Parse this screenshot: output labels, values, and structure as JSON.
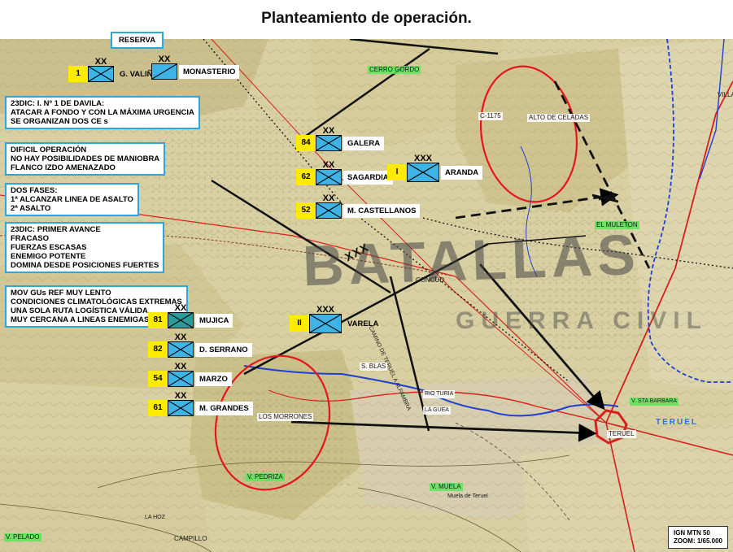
{
  "title": "Planteamiento de operación.",
  "reserva_label": "RESERVA",
  "notes": [
    {
      "id": "davila",
      "lines": [
        "23DIC: I. Nº 1 DE DAVILA:",
        "ATACAR A FONDO Y CON LA MÁXIMA URGENCIA",
        "SE ORGANIZAN DOS CE s"
      ]
    },
    {
      "id": "dificil",
      "lines": [
        "DIFICIL OPERACIÓN",
        "NO HAY POSIBILIDADES DE MANIOBRA",
        "FLANCO IZDO AMENAZADO"
      ]
    },
    {
      "id": "fases",
      "lines": [
        "DOS FASES:",
        "1ª ALCANZAR LINEA DE ASALTO",
        "2ª ASALTO"
      ]
    },
    {
      "id": "avance",
      "lines": [
        "23DIC: PRIMER AVANCE",
        "FRACASO",
        "FUERZAS ESCASAS",
        "ENEMIGO POTENTE",
        "DOMINA DESDE POSICIONES FUERTES"
      ]
    },
    {
      "id": "mov",
      "lines": [
        "MOV GUs REF MUY LENTO",
        "CONDICIONES CLIMATOLÓGICAS EXTREMAS",
        "UNA SOLA RUTA LOGÍSTICA VÁLIDA",
        "MUY CERCANA A LINEAS ENEMIGAS"
      ]
    }
  ],
  "units": [
    {
      "id": "valino",
      "number": "1",
      "echelon": "XX",
      "name": "G. VALIÑO"
    },
    {
      "id": "monasterio",
      "number": "",
      "echelon": "XX",
      "name": "MONASTERIO"
    },
    {
      "id": "galera",
      "number": "84",
      "echelon": "XX",
      "name": "GALERA"
    },
    {
      "id": "sagardia",
      "number": "62",
      "echelon": "XX",
      "name": "SAGARDIA"
    },
    {
      "id": "castellanos",
      "number": "52",
      "echelon": "XX",
      "name": "M. CASTELLANOS"
    },
    {
      "id": "aranda",
      "number": "I",
      "echelon": "XXX",
      "name": "ARANDA"
    },
    {
      "id": "mujica",
      "number": "81",
      "echelon": "XX",
      "name": "MUJICA"
    },
    {
      "id": "serrano",
      "number": "82",
      "echelon": "XX",
      "name": "D. SERRANO"
    },
    {
      "id": "marzo",
      "number": "54",
      "echelon": "XX",
      "name": "MARZO"
    },
    {
      "id": "grandes",
      "number": "61",
      "echelon": "XX",
      "name": "M. GRANDES"
    },
    {
      "id": "varela",
      "number": "II",
      "echelon": "XXX",
      "name": "VARELA"
    }
  ],
  "boundary_label": "XXX",
  "places": {
    "cerro_gordo": "CERRO GORDO",
    "alto_celadas": "ALTO DE CELADAS",
    "c1175": "C-1175",
    "mulleton": "EL MULETON",
    "concud": "CONCUD",
    "s_blas": "S. BLAS",
    "rio_turia": "RIO TURIA",
    "la_guea": "LA GUEA",
    "los_morrones": "LOS MORRONES",
    "v_pedriza": "V. PEDRIZA",
    "v_muela": "V. MUELA",
    "teruel": "TERUEL",
    "sta_barbara": "V. STA BARBARA",
    "v_pelado": "V. PELADO",
    "campillo": "CAMPILLO",
    "la_hoz": "LA HOZ",
    "villalba": "VILLALBA",
    "camino": "CAMINO DE TERUEL A ALFAMBRA",
    "teruel_map": "TERUEL",
    "muela": "Muela de Teruel"
  },
  "scale": {
    "line1": "IGN MTN 50",
    "line2": "ZOOM: 1/65.000"
  },
  "watermark": {
    "main": "BATALLAS",
    "sub": "GUERRA CIVIL"
  },
  "colors": {
    "map_base": "#d9d1a4",
    "unit_fill": "#3eb4e6",
    "number_badge": "#ffeb00",
    "box_border": "#2aa7dc",
    "attack_arrow": "#000000",
    "objective_circle": "#e8141b",
    "river": "#1f3fd0",
    "road_red": "#d6201c",
    "city_ring": "#d6201c"
  }
}
